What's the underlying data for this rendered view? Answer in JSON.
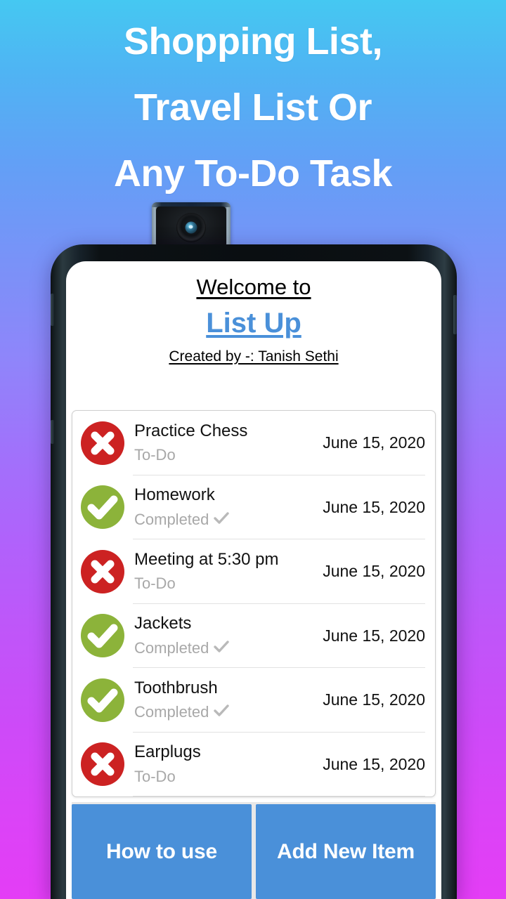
{
  "promo": {
    "headline_lines": [
      "Shopping List,",
      "Travel List Or",
      "Any To-Do Task"
    ],
    "text_color": "#ffffff",
    "background_top": "#45c8f2",
    "background_bottom": "#e43df6"
  },
  "device": {
    "camera_icon": "popup-selfie-camera-icon"
  },
  "app": {
    "welcome_text": "Welcome to ",
    "app_name": "List Up",
    "credit": "Created by -: Tanish Sethi",
    "accent_color": "#4a90d9",
    "todo_color": "#cc2222",
    "completed_color": "#8cb33a",
    "items": [
      {
        "title": "Practice Chess",
        "status": "To-Do",
        "date": "June 15, 2020",
        "done": false,
        "icon": "red-cross-circle-icon"
      },
      {
        "title": "Homework",
        "status": "Completed",
        "date": "June 15, 2020",
        "done": true,
        "icon": "green-check-circle-icon"
      },
      {
        "title": "Meeting at 5:30 pm",
        "status": "To-Do",
        "date": "June 15, 2020",
        "done": false,
        "icon": "red-cross-circle-icon"
      },
      {
        "title": "Jackets",
        "status": "Completed",
        "date": "June 15, 2020",
        "done": true,
        "icon": "green-check-circle-icon"
      },
      {
        "title": "Toothbrush",
        "status": "Completed",
        "date": "June 15, 2020",
        "done": true,
        "icon": "green-check-circle-icon"
      },
      {
        "title": "Earplugs",
        "status": "To-Do",
        "date": "June 15, 2020",
        "done": false,
        "icon": "red-cross-circle-icon"
      }
    ],
    "buttons": {
      "how_to_use": "How to use",
      "add_new_item": "Add New Item"
    }
  }
}
